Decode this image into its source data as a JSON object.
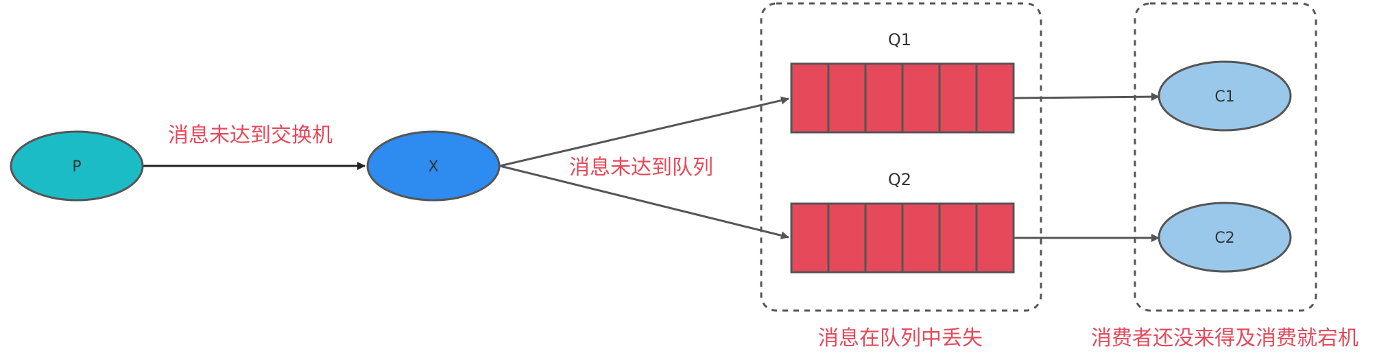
{
  "nodes": {
    "producer": {
      "label": "P",
      "color": "#1CBCC6"
    },
    "exchange": {
      "label": "X",
      "color": "#2E8BEF"
    },
    "consumer1": {
      "label": "C1",
      "color": "#9AC8EA"
    },
    "consumer2": {
      "label": "C2",
      "color": "#9AC8EA"
    }
  },
  "queues": {
    "q1": {
      "label": "Q1",
      "slot_count": 6,
      "color": "#E5495A"
    },
    "q2": {
      "label": "Q2",
      "slot_count": 6,
      "color": "#E5495A"
    }
  },
  "annotations": {
    "not_reach_exchange": "消息未达到交换机",
    "not_reach_queue": "消息未达到队列",
    "lost_in_queue": "消息在队列中丢失",
    "consumer_crash": "消费者还没来得及消费就宕机"
  },
  "colors": {
    "annotation": "#E5495A",
    "stroke": "#555555",
    "arrow_main": "#222222"
  }
}
